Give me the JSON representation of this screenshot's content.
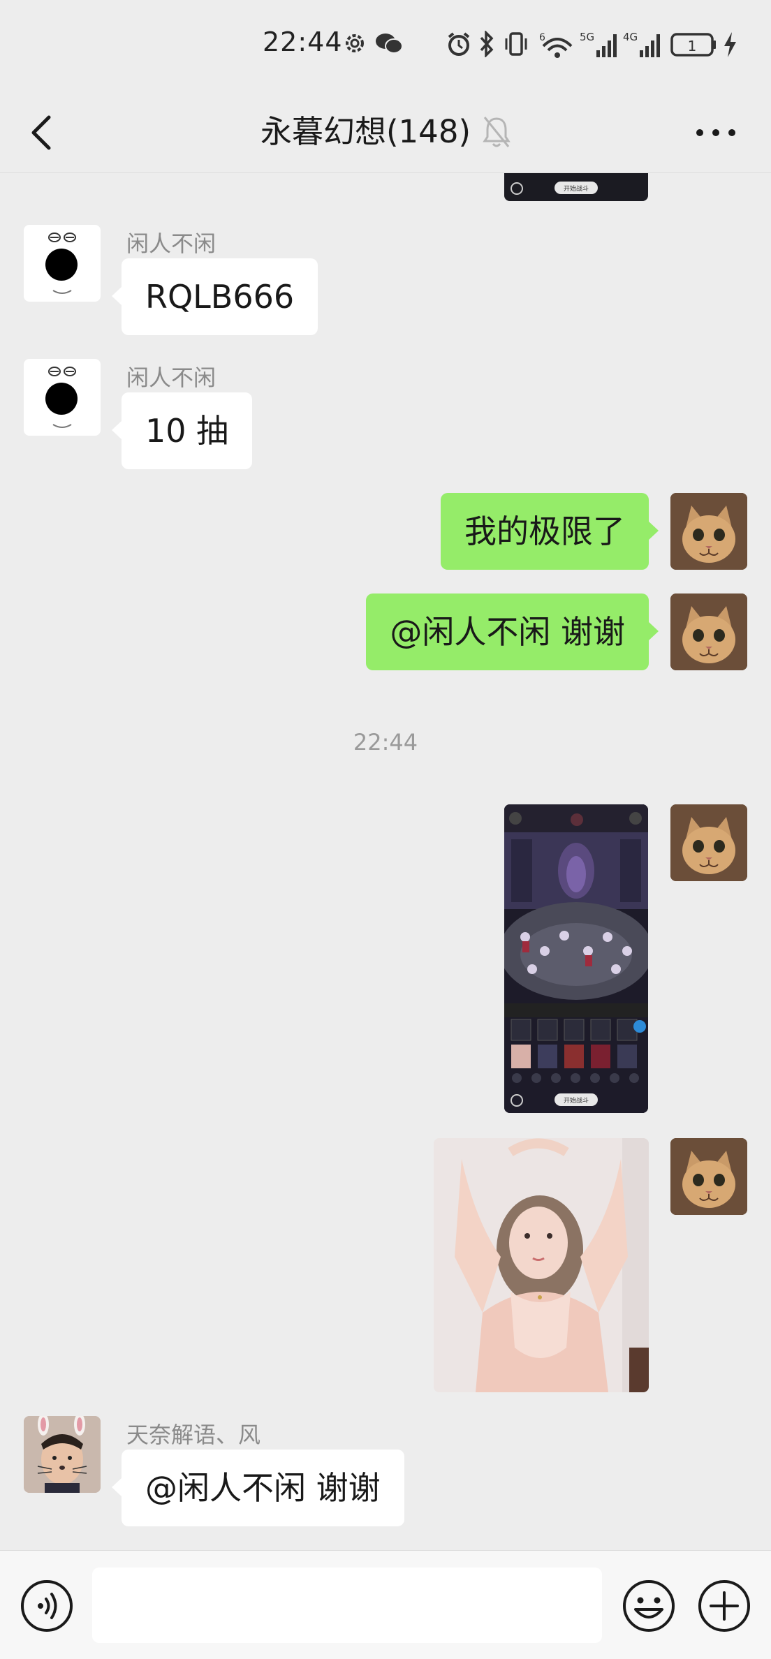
{
  "status_bar": {
    "time": "22:44",
    "battery_level": "1",
    "network_labels": [
      "6",
      "5G",
      "4G"
    ]
  },
  "header": {
    "title": "永暮幻想(148)"
  },
  "messages": [
    {
      "sender": "闲人不闲",
      "text": "RQLB666"
    },
    {
      "sender": "闲人不闲",
      "text": "10 抽"
    },
    {
      "text": "我的极限了"
    },
    {
      "text": "@闲人不闲  谢谢"
    },
    {
      "timestamp": "22:44"
    },
    {
      "sender": "天奈解语、风",
      "text": "@闲人不闲  谢谢"
    }
  ],
  "game_screenshot": {
    "button_label": "开始战斗"
  },
  "icons": {
    "back": "chevron-left-icon",
    "mute": "bell-off-icon",
    "more": "ellipsis-icon",
    "voice": "voice-icon",
    "emoji": "emoji-icon",
    "plus": "plus-icon"
  },
  "colors": {
    "outgoing_bubble": "#95ec69",
    "incoming_bubble": "#ffffff",
    "background": "#ededed"
  }
}
